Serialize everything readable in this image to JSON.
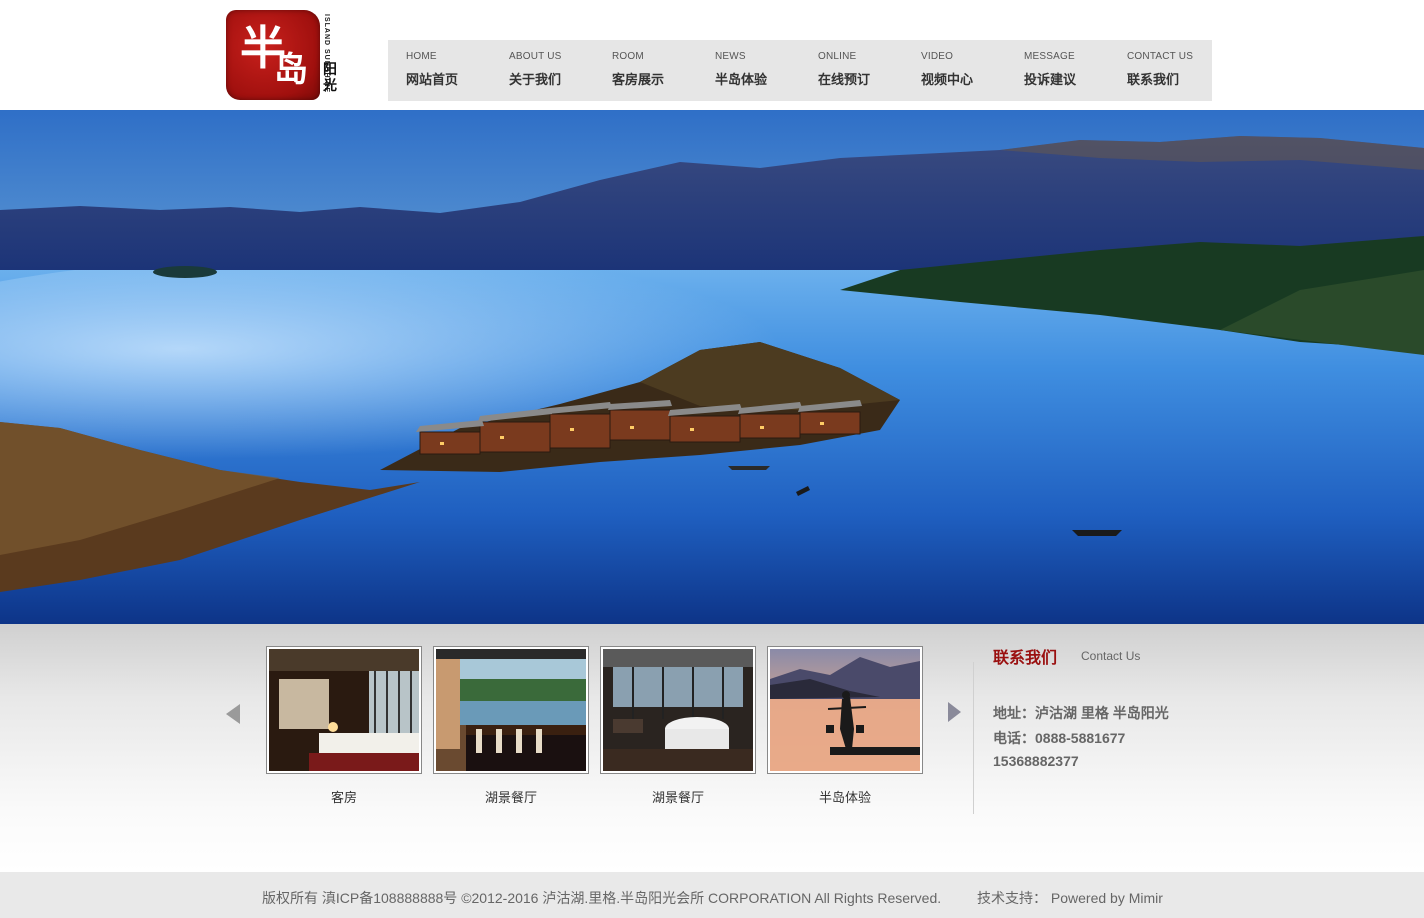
{
  "logo": {
    "seal_chars": [
      "半",
      "岛"
    ],
    "english": "ISLAND SUNSHINE",
    "chinese": "阳光"
  },
  "nav": [
    {
      "en": "HOME",
      "cn": "网站首页"
    },
    {
      "en": "ABOUT US",
      "cn": "关于我们"
    },
    {
      "en": "ROOM",
      "cn": "客房展示"
    },
    {
      "en": "NEWS",
      "cn": "半岛体验"
    },
    {
      "en": "ONLINE",
      "cn": "在线预订"
    },
    {
      "en": "VIDEO",
      "cn": "视频中心"
    },
    {
      "en": "MESSAGE",
      "cn": "投诉建议"
    },
    {
      "en": "CONTACT US",
      "cn": "联系我们"
    }
  ],
  "gallery": [
    {
      "caption": "客房"
    },
    {
      "caption": "湖景餐厅"
    },
    {
      "caption": "湖景餐厅"
    },
    {
      "caption": "半岛体验"
    }
  ],
  "contact": {
    "title": "联系我们",
    "title_en": "Contact Us",
    "address": "地址：泸沽湖 里格 半岛阳光",
    "phone": "电话：0888-5881677",
    "mobile": "15368882377"
  },
  "footer": {
    "copyright": "版权所有 滇ICP备108888888号 ©2012-2016 泸沽湖.里格.半岛阳光会所 CORPORATION All Rights Reserved.",
    "support": "技术支持： Powered by Mimir"
  },
  "colors": {
    "nav_bg": "#e6e6e6",
    "accent_red": "#9a1010",
    "lake_blue": "#1e5fb8",
    "footer_bg": "#e9e9e9"
  }
}
